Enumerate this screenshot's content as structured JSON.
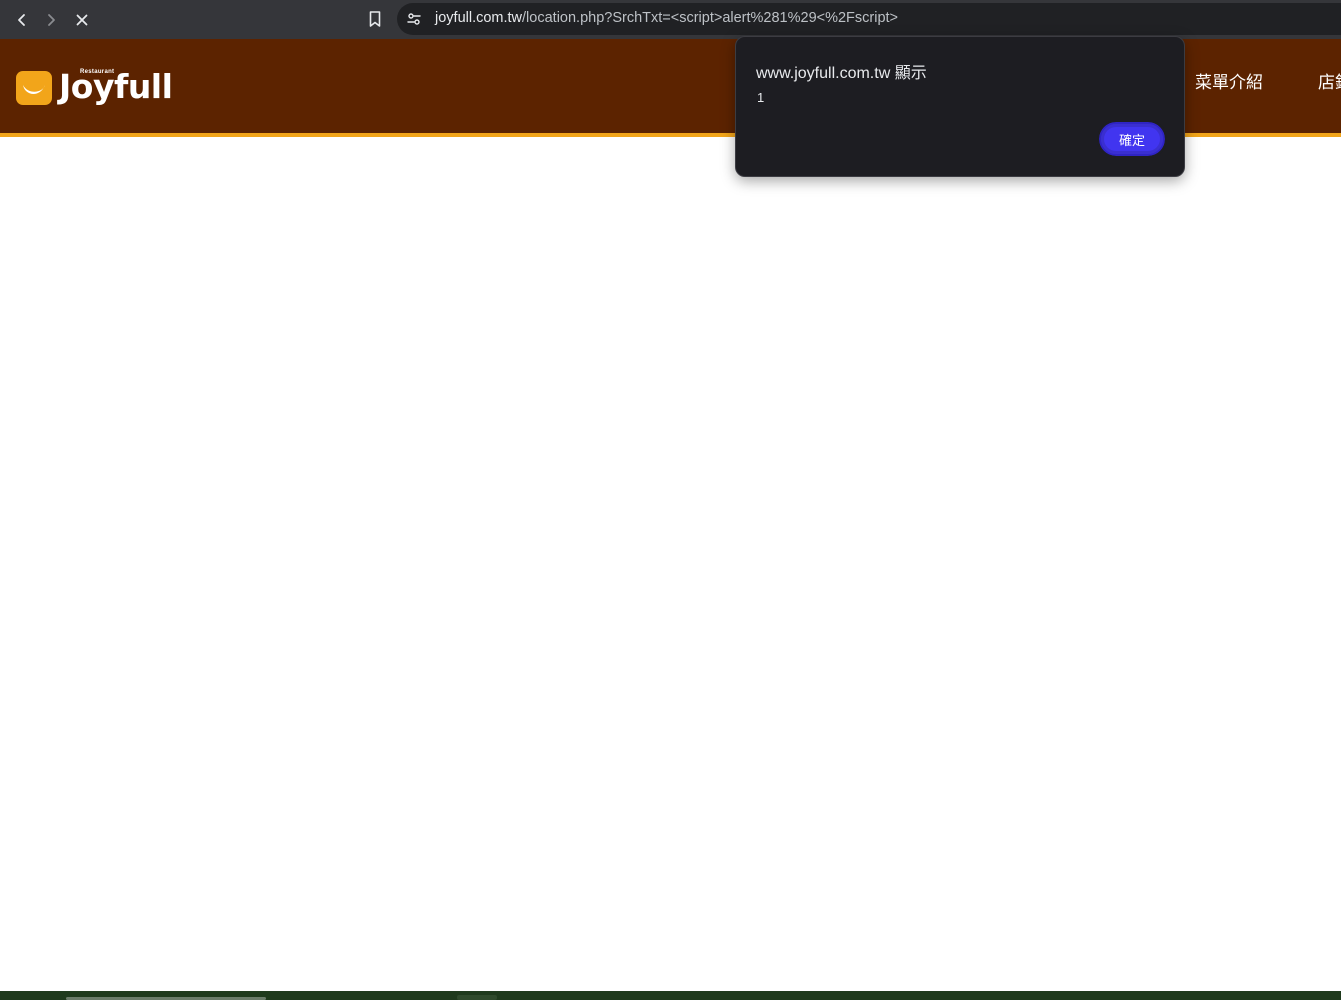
{
  "browser": {
    "url_host": "joyfull.com.tw",
    "url_rest": "/location.php?SrchTxt=<script>alert%281%29<%2Fscript>",
    "icons": {
      "back": "back-arrow-icon",
      "forward": "forward-arrow-icon",
      "stop": "close-icon",
      "bookmark": "bookmark-icon",
      "site_info": "site-settings-icon"
    }
  },
  "site": {
    "logo_sub": "Restaurant",
    "logo_text": "Joyfull",
    "nav": [
      "菜單介紹",
      "店鋪"
    ],
    "colors": {
      "header": "#5c2300",
      "stripe": "#f2a51a",
      "logo_mark": "#f2a51a"
    }
  },
  "dialog": {
    "title": "www.joyfull.com.tw 顯示",
    "message": "1",
    "ok_label": "確定",
    "colors": {
      "background": "#1d1d22",
      "button": "#4135f0"
    }
  }
}
